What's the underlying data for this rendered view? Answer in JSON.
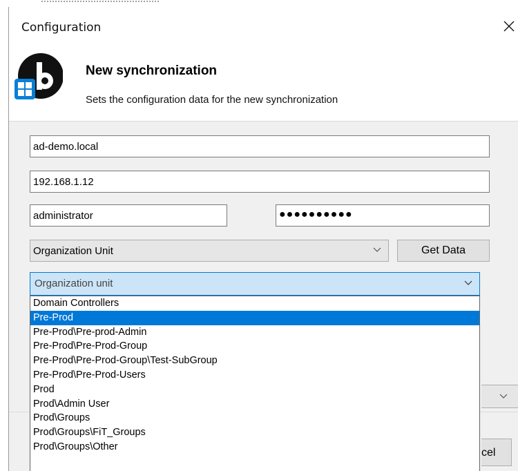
{
  "window": {
    "title": "Configuration",
    "close_glyph": "✕"
  },
  "header": {
    "title": "New synchronization",
    "subtitle": "Sets the configuration data for the new synchronization"
  },
  "form": {
    "domain_value": "ad-demo.local",
    "server_value": "192.168.1.12",
    "username_value": "administrator",
    "password_value": "●●●●●●●●●●",
    "object_type_selected": "Organization Unit",
    "get_data_label": "Get Data",
    "ou_combo_selected": "Organization unit",
    "cancel_partial_label": "cel"
  },
  "ou_options": [
    {
      "label": "Domain Controllers",
      "selected": false
    },
    {
      "label": "Pre-Prod",
      "selected": true
    },
    {
      "label": "Pre-Prod\\Pre-prod-Admin",
      "selected": false
    },
    {
      "label": "Pre-Prod\\Pre-Prod-Group",
      "selected": false
    },
    {
      "label": "Pre-Prod\\Pre-Prod-Group\\Test-SubGroup",
      "selected": false
    },
    {
      "label": "Pre-Prod\\Pre-Prod-Users",
      "selected": false
    },
    {
      "label": "Prod",
      "selected": false
    },
    {
      "label": "Prod\\Admin User",
      "selected": false
    },
    {
      "label": "Prod\\Groups",
      "selected": false
    },
    {
      "label": "Prod\\Groups\\FiT_Groups",
      "selected": false
    },
    {
      "label": "Prod\\Groups\\Other",
      "selected": false
    }
  ],
  "colors": {
    "selection": "#0078d7",
    "combo_focus_bg": "#cce4f7",
    "dialog_bg": "#f0f0f0",
    "logo_dark": "#111111",
    "logo_windows": "#0a7fd6"
  },
  "icons": {
    "close": "close-icon",
    "chevron": "chevron-down-icon",
    "logo": "app-logo-icon"
  }
}
